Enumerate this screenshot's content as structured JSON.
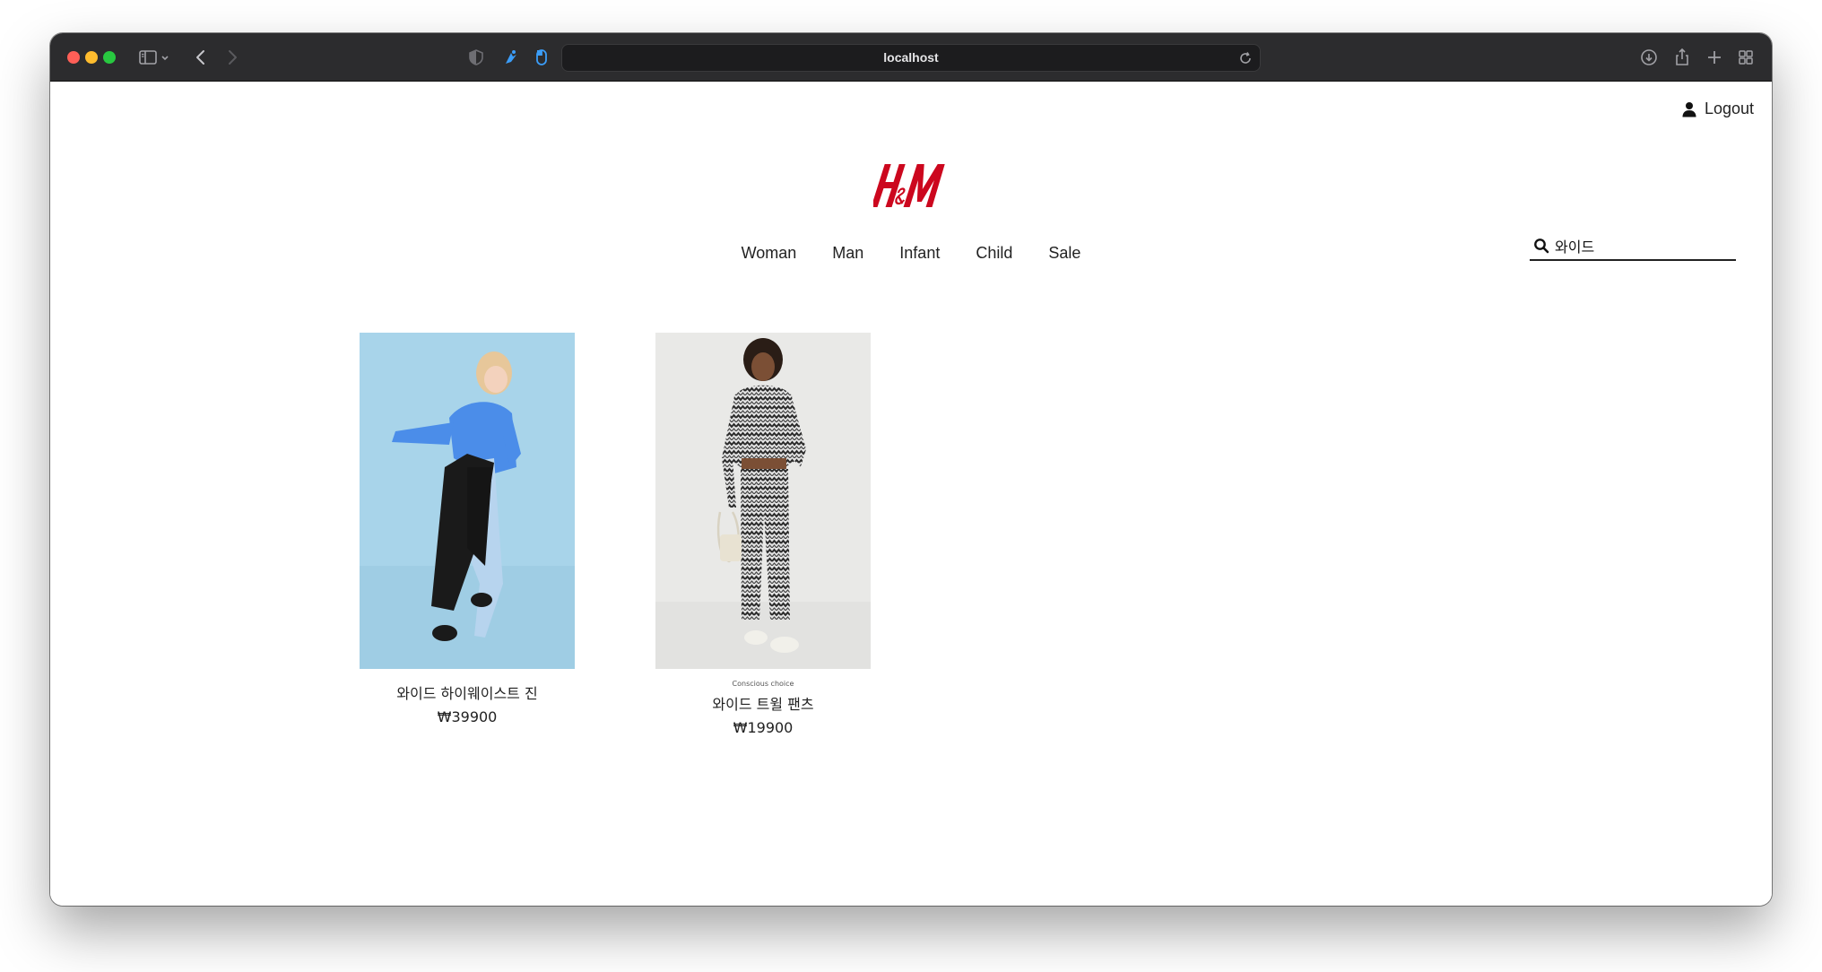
{
  "browser": {
    "url": "localhost",
    "colors": {
      "titlebar": "#2c2c2e",
      "urlbar": "#1c1c1e",
      "accent": "#3b82f6"
    },
    "icons": [
      "sidebar-icon",
      "chevron-down-icon",
      "back-icon",
      "forward-icon",
      "shield-icon",
      "extension-icon",
      "mouse-icon",
      "reload-icon",
      "download-icon",
      "share-icon",
      "new-tab-icon",
      "tab-overview-icon"
    ]
  },
  "header": {
    "logout_label": "Logout",
    "logo_text": "H&M",
    "logo_color": "#cc071e"
  },
  "nav": {
    "items": [
      {
        "label": "Woman"
      },
      {
        "label": "Man"
      },
      {
        "label": "Infant"
      },
      {
        "label": "Child"
      },
      {
        "label": "Sale"
      }
    ]
  },
  "search": {
    "value": "와이드",
    "icon": "search-icon"
  },
  "products": [
    {
      "badge": "",
      "name": "와이드 하이웨이스트 진",
      "price": "₩39900",
      "image_bg": "#a8d4ea"
    },
    {
      "badge": "Conscious choice",
      "name": "와이드 트윌 팬츠",
      "price": "₩19900",
      "image_bg": "#e9e9e7"
    }
  ]
}
